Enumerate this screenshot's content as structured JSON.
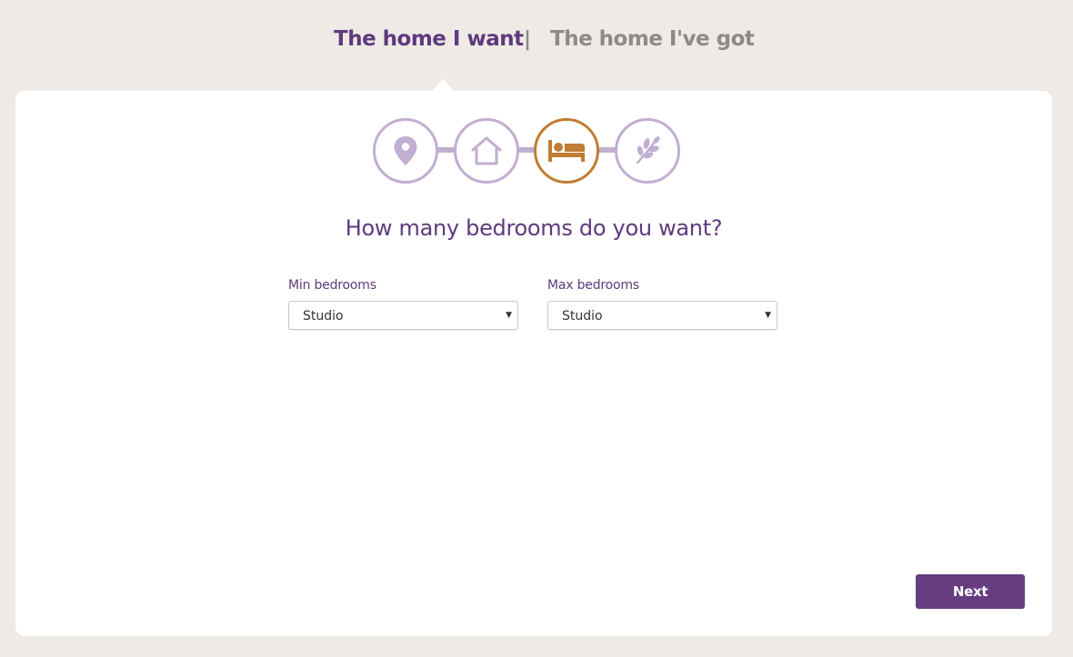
{
  "nav": {
    "tabs": [
      {
        "label": "The home I want",
        "active": true
      },
      {
        "label": "The home I've got",
        "active": false
      }
    ],
    "separator": "|"
  },
  "steps": [
    {
      "icon": "location-pin-icon",
      "active": false
    },
    {
      "icon": "house-icon",
      "active": false
    },
    {
      "icon": "bed-icon",
      "active": true
    },
    {
      "icon": "leaf-icon",
      "active": false
    }
  ],
  "question": "How many bedrooms do you want?",
  "fields": {
    "min": {
      "label": "Min bedrooms",
      "value": "Studio"
    },
    "max": {
      "label": "Max bedrooms",
      "value": "Studio"
    }
  },
  "next_label": "Next",
  "colors": {
    "brand_purple": "#5e3a7e",
    "step_inactive": "#c2aed0",
    "step_active": "#c07d33",
    "background": "#efeae6"
  }
}
